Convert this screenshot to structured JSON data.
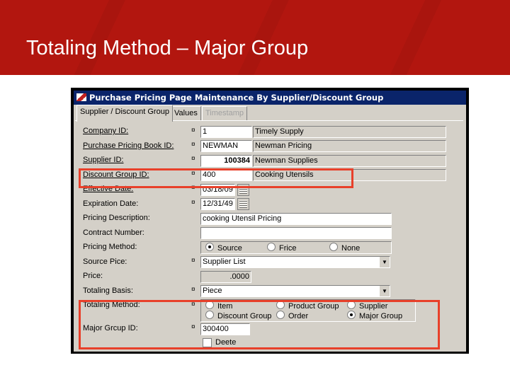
{
  "slide": {
    "title": "Totaling Method – Major Group"
  },
  "window": {
    "title": "Purchase Pricing Page Maintenance By Supplier/Discount Group",
    "tabs": [
      {
        "label": "Supplier / Discount Group",
        "state": "active"
      },
      {
        "label": "Values",
        "state": "normal"
      },
      {
        "label": "Timestamp",
        "state": "disabled"
      }
    ]
  },
  "form": {
    "company_id": {
      "label": "Company ID:",
      "value": "1",
      "desc": "Timely Supply"
    },
    "pricing_book_id": {
      "label": "Purchase Pricing Book ID:",
      "value": "NEWMAN",
      "desc": "Newman Pricing"
    },
    "supplier_id": {
      "label": "Supplier ID:",
      "value": "100384",
      "desc": "Newman Supplies"
    },
    "discount_group_id": {
      "label": "Discount Group ID:",
      "value": "400",
      "desc": "Cooking Utensils"
    },
    "effective_date": {
      "label": "Effective Date:",
      "value": "03/18/09"
    },
    "expiration_date": {
      "label": "Expiration Date:",
      "value": "12/31/49"
    },
    "pricing_description": {
      "label": "Pricing Description:",
      "value": "cooking Utensil Pricing"
    },
    "contract_number": {
      "label": "Contract Number:",
      "value": ""
    },
    "pricing_method": {
      "label": "Pricing Method:",
      "options": [
        "Source",
        "Frice",
        "None"
      ],
      "selected": "Source"
    },
    "source_price": {
      "label": "Source Pice:",
      "value": "Supplier List"
    },
    "price": {
      "label": "Price:",
      "value": ".0000"
    },
    "totaling_basis": {
      "label": "Totaling Basis:",
      "value": "Piece"
    },
    "totaling_method": {
      "label": "Totaling Method:",
      "options": [
        "Item",
        "Product Group",
        "Supplier",
        "Discount Group",
        "Order",
        "Major Group"
      ],
      "selected": "Major Group"
    },
    "major_group_id": {
      "label": "Major Grcup ID:",
      "value": "300400"
    },
    "delete": {
      "label": "Deete",
      "checked": false
    },
    "required_marker": "¤"
  },
  "colors": {
    "banner": "#b2160f",
    "highlight": "#e8402a",
    "titlebar": "#0a246a",
    "dialog": "#d4d0c8"
  }
}
